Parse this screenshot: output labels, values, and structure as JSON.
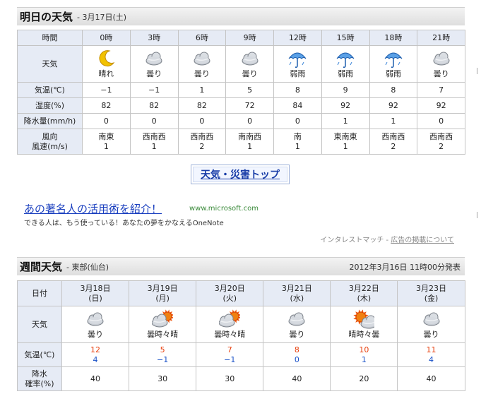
{
  "tomorrow": {
    "title": "明日の天気",
    "date": "- 3月17日(土)",
    "header_label": "時間",
    "hours": [
      "0時",
      "3時",
      "6時",
      "9時",
      "12時",
      "15時",
      "18時",
      "21時"
    ],
    "weather_label": "天気",
    "weather": [
      {
        "icon": "moon-icon",
        "text": "晴れ"
      },
      {
        "icon": "cloud-icon",
        "text": "曇り"
      },
      {
        "icon": "cloud-icon",
        "text": "曇り"
      },
      {
        "icon": "cloud-icon",
        "text": "曇り"
      },
      {
        "icon": "umbrella-icon",
        "text": "弱雨"
      },
      {
        "icon": "umbrella-icon",
        "text": "弱雨"
      },
      {
        "icon": "umbrella-icon",
        "text": "弱雨"
      },
      {
        "icon": "cloud-icon",
        "text": "曇り"
      }
    ],
    "temp_label": "気温(℃)",
    "temp": [
      "−1",
      "−1",
      "1",
      "5",
      "8",
      "9",
      "8",
      "7"
    ],
    "humidity_label": "湿度(%)",
    "humidity": [
      "82",
      "82",
      "82",
      "72",
      "84",
      "92",
      "92",
      "92"
    ],
    "precip_label": "降水量(mm/h)",
    "precip": [
      "0",
      "0",
      "0",
      "0",
      "0",
      "1",
      "1",
      "0"
    ],
    "wind_label_1": "風向",
    "wind_label_2": "風速(m/s)",
    "wind_dir": [
      "南東",
      "西南西",
      "西南西",
      "南南西",
      "南",
      "東南東",
      "西南西",
      "西南西"
    ],
    "wind_speed": [
      "1",
      "1",
      "2",
      "1",
      "1",
      "1",
      "2",
      "2"
    ]
  },
  "disaster_link": "天気・災害トップ",
  "ad": {
    "title": "あの著名人の活用術を紹介！",
    "url": "www.microsoft.com",
    "desc": "できる人は、もう使っている！あなたの夢をかなえるOneNote",
    "foot_prefix": "インタレストマッチ - ",
    "foot_link": "広告の掲載について"
  },
  "weekly": {
    "title": "週間天気",
    "region": "- 東部(仙台)",
    "issued": "2012年3月16日 11時00分発表",
    "date_label": "日付",
    "days": [
      {
        "date": "3月18日",
        "dow": "(日)",
        "icon": "cloud-icon",
        "text": "曇り",
        "hi": "12",
        "lo": "4",
        "pop": "40"
      },
      {
        "date": "3月19日",
        "dow": "(月)",
        "icon": "cloud-sun-icon",
        "text": "曇時々晴",
        "hi": "5",
        "lo": "−1",
        "pop": "30"
      },
      {
        "date": "3月20日",
        "dow": "(火)",
        "icon": "cloud-sun-icon",
        "text": "曇時々晴",
        "hi": "7",
        "lo": "−1",
        "pop": "30"
      },
      {
        "date": "3月21日",
        "dow": "(水)",
        "icon": "cloud-icon",
        "text": "曇り",
        "hi": "8",
        "lo": "0",
        "pop": "40"
      },
      {
        "date": "3月22日",
        "dow": "(木)",
        "icon": "sun-cloud-icon",
        "text": "晴時々曇",
        "hi": "10",
        "lo": "1",
        "pop": "20"
      },
      {
        "date": "3月23日",
        "dow": "(金)",
        "icon": "cloud-icon",
        "text": "曇り",
        "hi": "11",
        "lo": "4",
        "pop": "40"
      }
    ],
    "weather_label": "天気",
    "temp_label": "気温(℃)",
    "pop_label_1": "降水",
    "pop_label_2": "確率(%)"
  },
  "colors": {
    "high": "#e8400e",
    "low": "#1a52c8",
    "label_bg": "#e6ebf5",
    "link": "#1a3fbf"
  }
}
